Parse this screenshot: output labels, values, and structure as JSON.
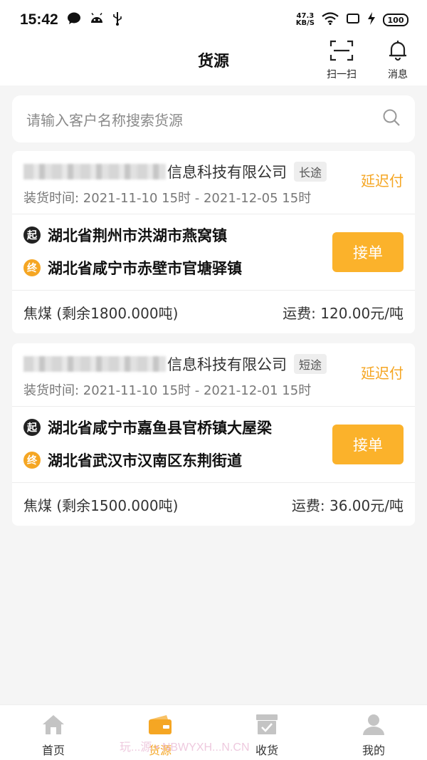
{
  "status_bar": {
    "time": "15:42",
    "net_speed_value": "47.3",
    "net_speed_unit": "KB/S",
    "battery": "100"
  },
  "header": {
    "title": "货源",
    "scan_label": "扫一扫",
    "message_label": "消息"
  },
  "search": {
    "placeholder": "请输入客户名称搜索货源"
  },
  "orders": [
    {
      "company_suffix": "信息科技有限公司",
      "distance_tag": "长途",
      "payment": "延迟付",
      "load_time": "装货时间: 2021-11-10 15时 - 2021-12-05 15时",
      "start_badge": "起",
      "start": "湖北省荆州市洪湖市燕窝镇",
      "end_badge": "终",
      "end": "湖北省咸宁市赤壁市官塘驿镇",
      "accept_label": "接单",
      "cargo": "焦煤 (剩余1800.000吨)",
      "freight": "运费: 120.00元/吨"
    },
    {
      "company_suffix": "信息科技有限公司",
      "distance_tag": "短途",
      "payment": "延迟付",
      "load_time": "装货时间: 2021-11-10 15时 - 2021-12-01 15时",
      "start_badge": "起",
      "start": "湖北省咸宁市嘉鱼县官桥镇大屋梁",
      "end_badge": "终",
      "end": "湖北省武汉市汉南区东荆街道",
      "accept_label": "接单",
      "cargo": "焦煤 (剩余1500.000吨)",
      "freight": "运费: 36.00元/吨"
    }
  ],
  "tabs": [
    {
      "label": "首页",
      "icon": "home-icon"
    },
    {
      "label": "货源",
      "icon": "cargo-icon",
      "active": true
    },
    {
      "label": "收货",
      "icon": "receive-icon"
    },
    {
      "label": "我的",
      "icon": "profile-icon"
    }
  ],
  "watermark": "玩...源 • NBWYXH...N.CN",
  "colors": {
    "accent": "#f5a623",
    "button": "#fbb22b",
    "background": "#f5f5f5"
  }
}
